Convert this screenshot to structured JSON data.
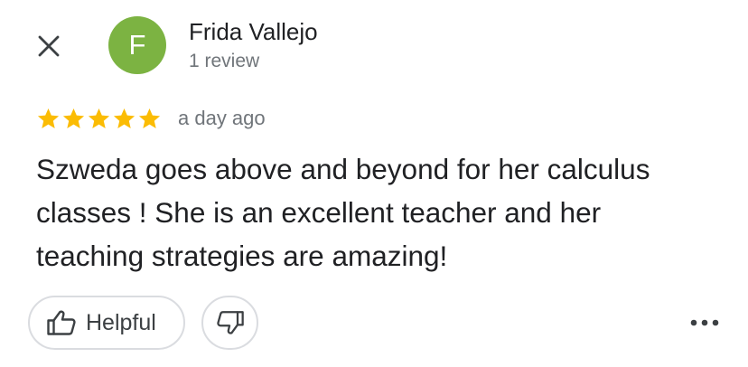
{
  "colors": {
    "avatar_bg": "#7cb342",
    "star": "#fbbc04",
    "icon": "#3c4043",
    "secondary_text": "#70757a",
    "button_border": "#dadce0"
  },
  "header": {
    "close_icon": "close-icon"
  },
  "reviewer": {
    "initial": "F",
    "name": "Frida Vallejo",
    "review_count": "1 review"
  },
  "review": {
    "rating": 5,
    "rating_max": 5,
    "time": "a day ago",
    "text": "Szweda goes above and beyond for her calculus classes ! She is an excellent teacher and her teaching strategies are amazing!"
  },
  "actions": {
    "helpful_label": "Helpful",
    "helpful_icon": "thumbs-up-icon",
    "not_helpful_icon": "thumbs-down-icon",
    "more_icon": "more-horizontal-icon"
  }
}
